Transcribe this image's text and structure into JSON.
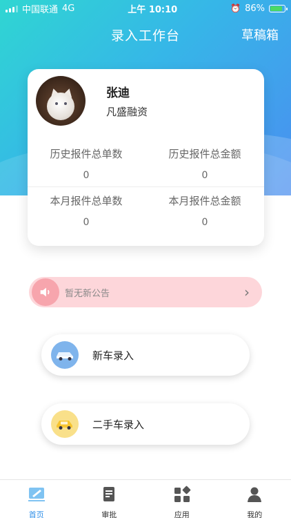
{
  "status_bar": {
    "carrier": "中国联通",
    "network": "4G",
    "time": "上午 10:10",
    "battery": "86%"
  },
  "nav": {
    "title": "录入工作台",
    "right_action": "草稿箱"
  },
  "profile": {
    "name": "张迪",
    "company": "凡盛融资"
  },
  "stats": [
    {
      "label": "历史报件总单数",
      "value": "0"
    },
    {
      "label": "历史报件总金额",
      "value": "0"
    },
    {
      "label": "本月报件总单数",
      "value": "0"
    },
    {
      "label": "本月报件总金额",
      "value": "0"
    }
  ],
  "notice": {
    "text": "暂无新公告"
  },
  "entries": {
    "new_car": "新车录入",
    "used_car": "二手车录入"
  },
  "tabs": [
    {
      "label": "首页",
      "icon": "home-icon",
      "active": true
    },
    {
      "label": "审批",
      "icon": "approval-icon",
      "active": false
    },
    {
      "label": "应用",
      "icon": "apps-icon",
      "active": false
    },
    {
      "label": "我的",
      "icon": "profile-icon",
      "active": false
    }
  ],
  "colors": {
    "accent": "#2f8fe8",
    "notice_bg": "#fdd6da",
    "gradient_start": "#2fd6d2",
    "gradient_end": "#4a8ef0"
  }
}
